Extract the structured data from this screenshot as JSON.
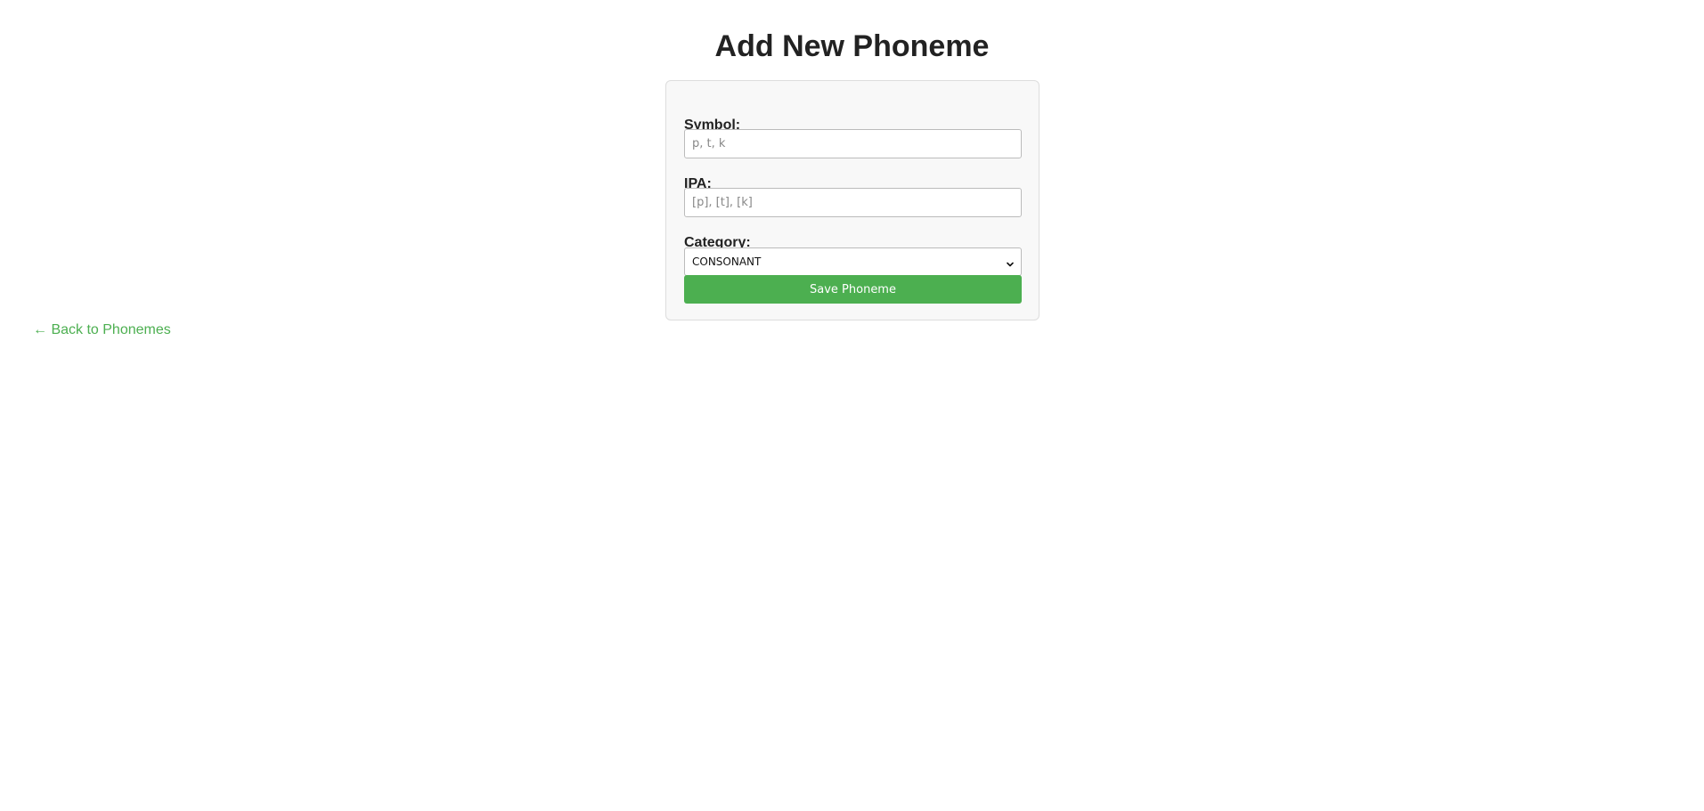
{
  "page": {
    "title": "Add New Phoneme"
  },
  "form": {
    "symbol": {
      "label": "Symbol:",
      "value": "",
      "placeholder": "p, t, k"
    },
    "ipa": {
      "label": "IPA:",
      "value": "",
      "placeholder": "[p], [t], [k]"
    },
    "category": {
      "label": "Category:",
      "selected": "CONSONANT"
    },
    "save_label": "Save Phoneme"
  },
  "nav": {
    "back_label": "← Back to Phonemes"
  },
  "colors": {
    "accent": "#4caf50",
    "card_background": "#f8f8f8",
    "card_border": "#dddddd"
  },
  "icons": {
    "select_chevron": "chevron-down-icon"
  }
}
